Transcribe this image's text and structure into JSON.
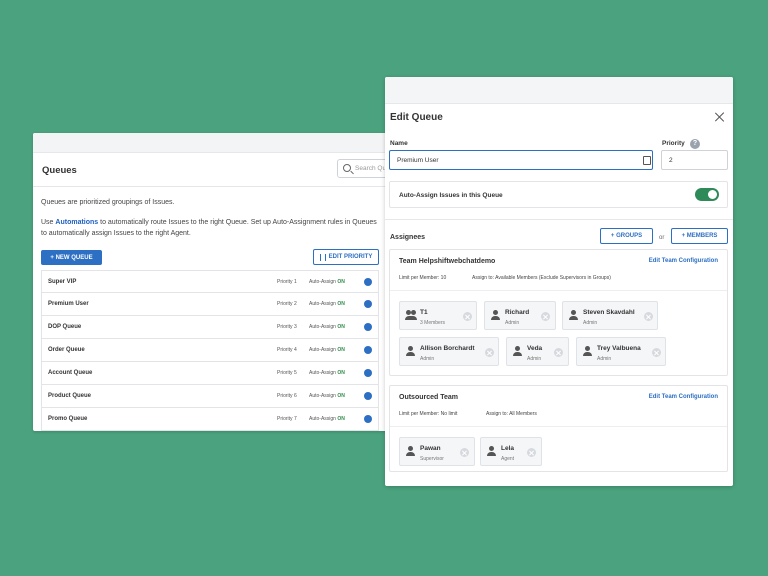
{
  "queues_panel": {
    "title": "Queues",
    "search_placeholder": "Search Que",
    "description": "Queues are prioritized groupings of Issues.",
    "info_prefix": "Use ",
    "info_link": "Automations",
    "info_suffix": " to automatically route Issues to the right Queue. Set up Auto-Assignment rules in Queues to automatically assign Issues to the right Agent.",
    "new_queue_label": "+ NEW QUEUE",
    "edit_priority_label": "EDIT PRIORITY",
    "auto_assign_prefix": "Auto-Assign ",
    "rows": [
      {
        "name": "Super VIP",
        "priority": "Priority 1",
        "auto_assign": "ON"
      },
      {
        "name": "Premium User",
        "priority": "Priority 2",
        "auto_assign": "ON"
      },
      {
        "name": "DOP Queue",
        "priority": "Priority 3",
        "auto_assign": "ON"
      },
      {
        "name": "Order Queue",
        "priority": "Priority 4",
        "auto_assign": "ON"
      },
      {
        "name": "Account Queue",
        "priority": "Priority 5",
        "auto_assign": "ON"
      },
      {
        "name": "Product Queue",
        "priority": "Priority 6",
        "auto_assign": "ON"
      },
      {
        "name": "Promo Queue",
        "priority": "Priority 7",
        "auto_assign": "ON"
      }
    ]
  },
  "edit_panel": {
    "title": "Edit Queue",
    "name_label": "Name",
    "name_value": "Premium User",
    "priority_label": "Priority",
    "priority_value": "2",
    "help_glyph": "?",
    "auto_assign_label": "Auto-Assign Issues in this Queue",
    "assignees_label": "Assignees",
    "groups_button": "+ GROUPS",
    "or_text": "or",
    "members_button": "+ MEMBERS",
    "teams": [
      {
        "name": "Team Helpshiftwebchatdemo",
        "config_link": "Edit Team Configuration",
        "limit": "Limit per Member: 10",
        "assign_to": "Assign to: Available Members (Exclude Supervisors in Groups)",
        "members": [
          {
            "name": "T1",
            "role": "3 Members"
          },
          {
            "name": "Richard",
            "role": "Admin"
          },
          {
            "name": "Steven Skavdahl",
            "role": "Admin"
          },
          {
            "name": "Allison Borchardt",
            "role": "Admin"
          },
          {
            "name": "Veda",
            "role": "Admin"
          },
          {
            "name": "Trey Valbuena",
            "role": "Admin"
          }
        ]
      },
      {
        "name": "Outsourced Team",
        "config_link": "Edit Team Configuration",
        "limit": "Limit per Member: No limit",
        "assign_to": "Assign to: All Members",
        "members": [
          {
            "name": "Pawan",
            "role": "Supervisor"
          },
          {
            "name": "Lela",
            "role": "Agent"
          }
        ]
      }
    ]
  },
  "colors": {
    "background": "#4aa37e",
    "accent": "#2d6fc3",
    "toggle_on": "#2f8a5a",
    "on_text": "#2f8a4a"
  },
  "icons": [
    "search-icon",
    "sort-icon",
    "gear-icon",
    "close-icon",
    "help-icon",
    "card-icon",
    "person-icon",
    "group-icon",
    "remove-icon",
    "toggle-switch"
  ]
}
